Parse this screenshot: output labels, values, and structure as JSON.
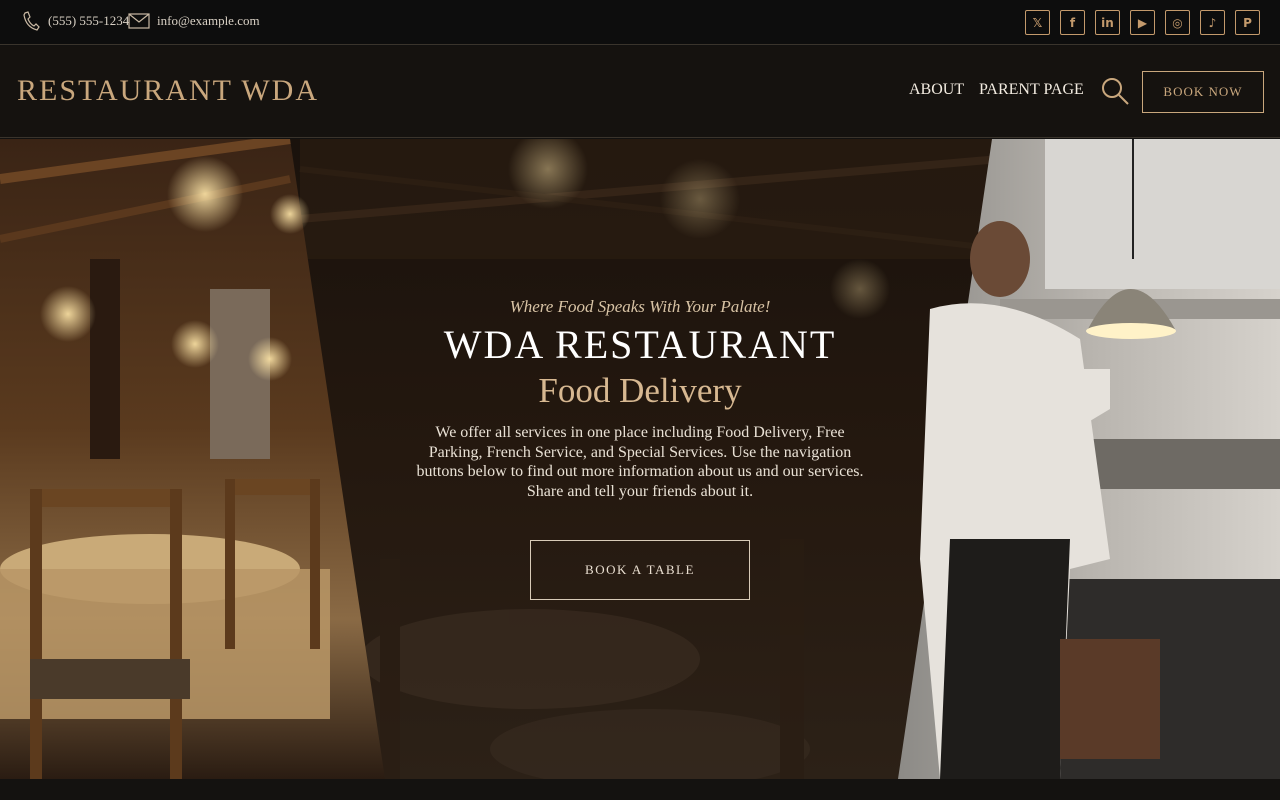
{
  "contact": {
    "phone": "(555) 555-1234",
    "email": "info@example.com"
  },
  "socials": [
    {
      "name": "x-icon",
      "glyph": "𝕏"
    },
    {
      "name": "facebook-icon",
      "glyph": "f"
    },
    {
      "name": "linkedin-icon",
      "glyph": "in"
    },
    {
      "name": "youtube-icon",
      "glyph": "▶"
    },
    {
      "name": "instagram-icon",
      "glyph": "◎"
    },
    {
      "name": "tiktok-icon",
      "glyph": "♪"
    },
    {
      "name": "pinterest-icon",
      "glyph": "P"
    }
  ],
  "header": {
    "brand": "RESTAURANT WDA",
    "nav": {
      "about": "ABOUT",
      "parent_page": "PARENT PAGE"
    },
    "book_now": "BOOK NOW"
  },
  "hero": {
    "tagline": "Where Food Speaks With Your Palate!",
    "title": "WDA RESTAURANT",
    "subtitle": "Food Delivery",
    "description": "We offer all services in one place including Food Delivery, Free Parking, French Service, and Special Services. Use the navigation buttons below to find out more information about us and our services. Share and tell your friends about it.",
    "cta": "BOOK A TABLE"
  },
  "colors": {
    "accent": "#c9a77d",
    "background": "#15120f",
    "topbar": "#0d0d0d"
  }
}
